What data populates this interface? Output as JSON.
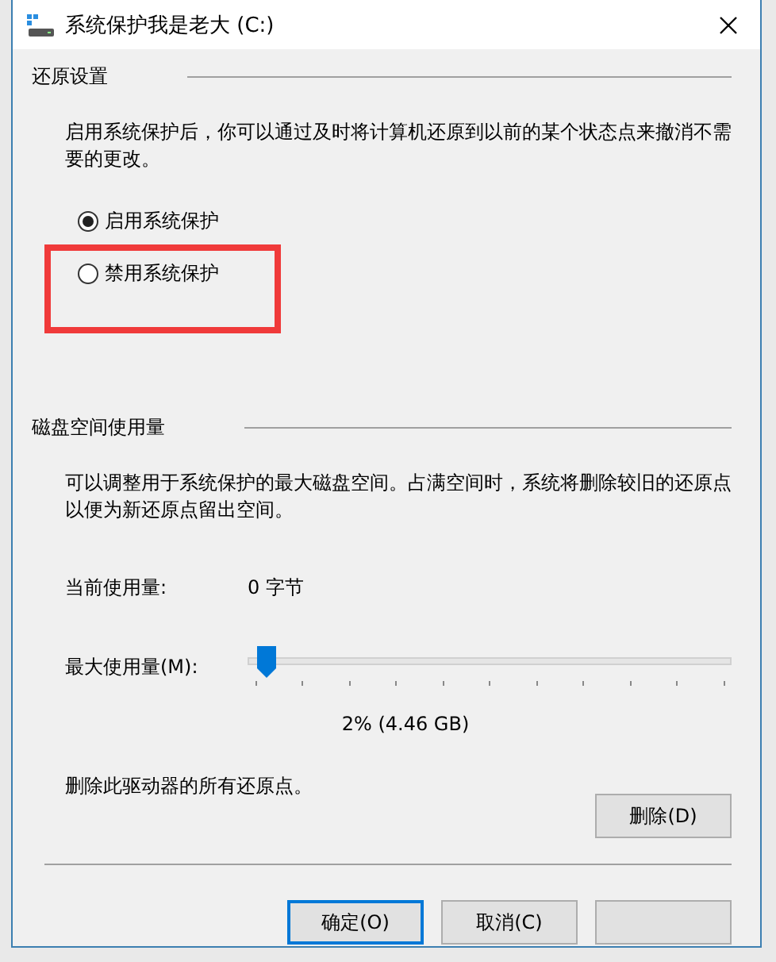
{
  "window": {
    "title": "系统保护我是老大 (C:)"
  },
  "restore_settings": {
    "heading": "还原设置",
    "description": "启用系统保护后，你可以通过及时将计算机还原到以前的某个状态点来撤消不需要的更改。",
    "options": [
      {
        "label": "启用系统保护",
        "selected": true,
        "highlighted": false
      },
      {
        "label": "禁用系统保护",
        "selected": false,
        "highlighted": true
      }
    ]
  },
  "disk_usage": {
    "heading": "磁盘空间使用量",
    "description": "可以调整用于系统保护的最大磁盘空间。占满空间时，系统将删除较旧的还原点以便为新还原点留出空间。",
    "current_label": "当前使用量:",
    "current_value": "0 字节",
    "max_label": "最大使用量(M):",
    "max_slider": {
      "level": 0.02
    },
    "max_reading": "2% (4.46 GB)",
    "delete_text": "删除此驱动器的所有还原点。",
    "delete_button": "删除(D)"
  },
  "buttons": [
    {
      "label": "确定(O)",
      "default": true
    },
    {
      "label": "取消(C)",
      "default": false
    },
    {
      "default": false
    }
  ]
}
